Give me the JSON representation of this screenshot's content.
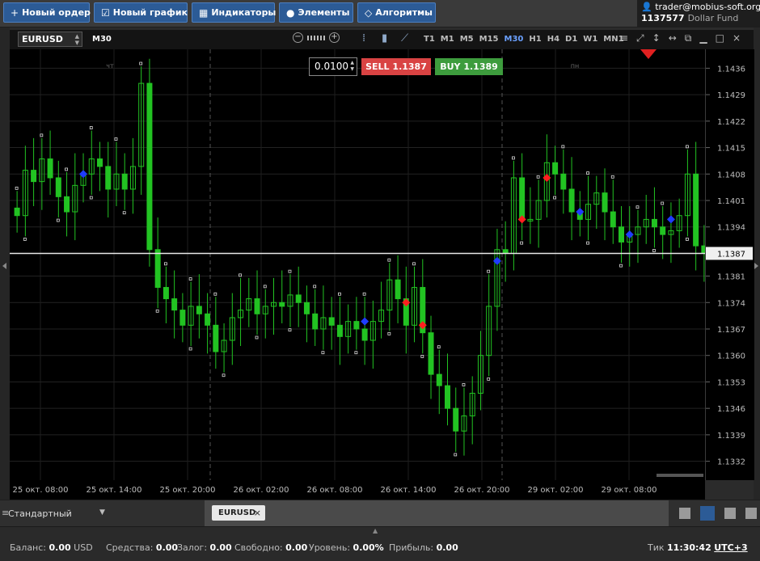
{
  "toolbar": {
    "new_order": "Новый ордер",
    "new_chart": "Новый график",
    "indicators": "Индикаторы",
    "elements": "Элементы",
    "algorithms": "Алгоритмы"
  },
  "account": {
    "user": "trader@mobius-soft.org",
    "number": "1137577",
    "fund_name": "Dollar Fund"
  },
  "chart_header": {
    "symbol": "EURUSD",
    "timeframe": "M30",
    "periods": [
      "T1",
      "M1",
      "M5",
      "M15",
      "M30",
      "H1",
      "H4",
      "D1",
      "W1",
      "MN1"
    ],
    "active_period": "M30"
  },
  "trade": {
    "lot": "0.0100",
    "sell_label": "SELL",
    "sell_price": "1.1387",
    "buy_label": "BUY",
    "buy_price": "1.1389"
  },
  "chart_data": {
    "type": "candlestick",
    "symbol": "EURUSD",
    "timeframe": "M30",
    "current_price": "1.1387",
    "price_ticks": [
      "1.1436",
      "1.1429",
      "1.1422",
      "1.1415",
      "1.1408",
      "1.1401",
      "1.1394",
      "1.1381",
      "1.1374",
      "1.1367",
      "1.1360",
      "1.1353",
      "1.1346",
      "1.1339",
      "1.1332"
    ],
    "price_tick_values": [
      1.1436,
      1.1429,
      1.1422,
      1.1415,
      1.1408,
      1.1401,
      1.1394,
      1.1381,
      1.1374,
      1.1367,
      1.136,
      1.1353,
      1.1346,
      1.1339,
      1.1332
    ],
    "y_range": [
      1.1327,
      1.1441
    ],
    "time_ticks": [
      "25 окт. 08:00",
      "25 окт. 14:00",
      "25 окт. 20:00",
      "26 окт. 02:00",
      "26 окт. 08:00",
      "26 окт. 14:00",
      "26 окт. 20:00",
      "29 окт. 02:00",
      "29 окт. 08:00"
    ],
    "day_labels": [
      "чт",
      "пт",
      "пн"
    ],
    "closes": [
      1.1397,
      1.1409,
      1.1406,
      1.1412,
      1.1407,
      1.1402,
      1.1398,
      1.1405,
      1.1408,
      1.1412,
      1.141,
      1.1404,
      1.1408,
      1.1404,
      1.141,
      1.1432,
      1.1388,
      1.1378,
      1.1375,
      1.1372,
      1.1368,
      1.1373,
      1.1371,
      1.1368,
      1.1361,
      1.1364,
      1.137,
      1.1372,
      1.1375,
      1.1371,
      1.1373,
      1.1374,
      1.1373,
      1.1376,
      1.1374,
      1.1371,
      1.1367,
      1.137,
      1.1368,
      1.1365,
      1.1369,
      1.1367,
      1.1364,
      1.1369,
      1.1372,
      1.138,
      1.1375,
      1.1368,
      1.1378,
      1.1366,
      1.1355,
      1.1352,
      1.1346,
      1.134,
      1.1344,
      1.135,
      1.136,
      1.1373,
      1.1388,
      1.1387,
      1.1407,
      1.1396,
      1.1396,
      1.1401,
      1.1411,
      1.1408,
      1.1404,
      1.1398,
      1.1396,
      1.14,
      1.1403,
      1.1398,
      1.1394,
      1.139,
      1.1392,
      1.1394,
      1.1396,
      1.1394,
      1.1392,
      1.1393,
      1.1397,
      1.1408,
      1.1389,
      1.1387
    ],
    "markers": [
      {
        "color": "blue",
        "index": 8,
        "price": 1.1408
      },
      {
        "color": "red",
        "index": 61,
        "price": 1.1396
      },
      {
        "color": "red",
        "index": 64,
        "price": 1.1407
      },
      {
        "color": "blue",
        "index": 68,
        "price": 1.1398
      },
      {
        "color": "blue",
        "index": 74,
        "price": 1.1392
      },
      {
        "color": "blue",
        "index": 79,
        "price": 1.1396
      },
      {
        "color": "blue",
        "index": 42,
        "price": 1.1369
      },
      {
        "color": "red",
        "index": 47,
        "price": 1.1374
      },
      {
        "color": "red",
        "index": 49,
        "price": 1.1368
      },
      {
        "color": "blue",
        "index": 58,
        "price": 1.1385
      }
    ]
  },
  "bottom": {
    "preset": "Стандартный",
    "tab": "EURUSD"
  },
  "status": {
    "balance_label": "Баланс:",
    "balance_value": "0.00",
    "balance_currency": "USD",
    "funds_label": "Средства:",
    "funds_value": "0.00",
    "margin_label": "Залог:",
    "margin_value": "0.00",
    "free_label": "Свободно:",
    "free_value": "0.00",
    "level_label": "Уровень:",
    "level_value": "0.00%",
    "profit_label": "Прибыль:",
    "profit_value": "0.00",
    "tick_label": "Тик",
    "tick_time": "11:30:42",
    "timezone": "UTC+3"
  },
  "colors": {
    "bull": "#22c322",
    "bear": "#22c322",
    "blue_marker": "#1f3cff",
    "red_marker": "#ff1f1f",
    "price_line": "#e8e8e8",
    "accent": "#2c5b96"
  }
}
